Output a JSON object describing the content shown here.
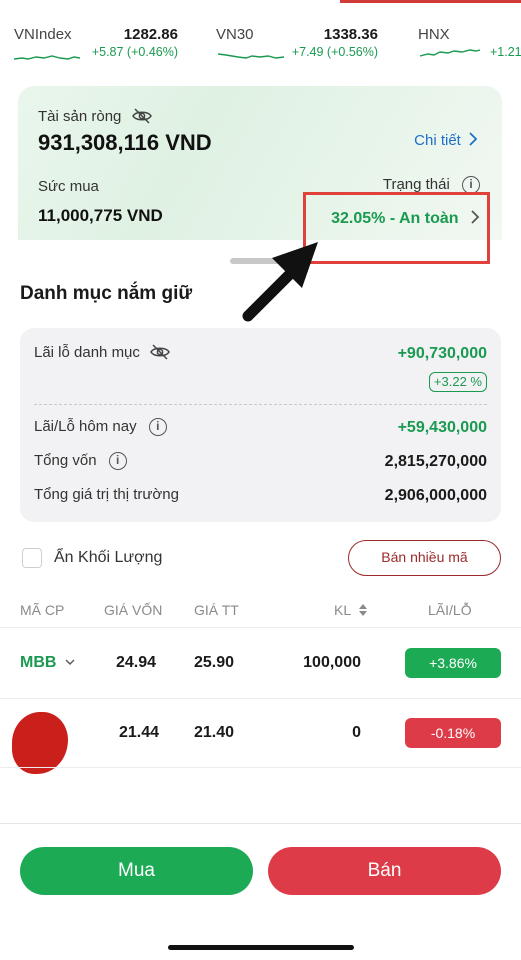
{
  "ticker": [
    {
      "name": "VNIndex",
      "value": "1282.86",
      "change": "+5.87 (+0.46%)"
    },
    {
      "name": "VN30",
      "value": "1338.36",
      "change": "+7.49 (+0.56%)"
    },
    {
      "name": "HNX",
      "value": "",
      "change": "+1.21"
    }
  ],
  "asset": {
    "net_label": "Tài sản ròng",
    "net_value": "931,308,116 VND",
    "detail_link": "Chi tiết",
    "buying_power_label": "Sức mua",
    "buying_power_value": "11,000,775 VND",
    "status_label": "Trạng thái",
    "status_value": "32.05% - An toàn"
  },
  "portfolio": {
    "title": "Danh mục nắm giữ",
    "pnl_label": "Lãi lỗ danh mục",
    "pnl_value": "+90,730,000",
    "pnl_pct": "+3.22 %",
    "today_label": "Lãi/Lỗ hôm nay",
    "today_value": "+59,430,000",
    "capital_label": "Tổng vốn",
    "capital_value": "2,815,270,000",
    "market_label": "Tổng giá trị thị trường",
    "market_value": "2,906,000,000"
  },
  "controls": {
    "hide_volume": "Ẩn Khối Lượng",
    "sell_multi": "Bán nhiều mã"
  },
  "table": {
    "headers": [
      "MÃ CP",
      "GIÁ VỐN",
      "GIÁ TT",
      "KL",
      "LÃI/LỖ"
    ],
    "rows": [
      {
        "code": "MBB",
        "cost": "24.94",
        "price": "25.90",
        "qty": "100,000",
        "pl": "+3.86%",
        "pl_sign": "positive"
      },
      {
        "code": "",
        "cost": "21.44",
        "price": "21.40",
        "qty": "0",
        "pl": "-0.18%",
        "pl_sign": "negative"
      }
    ]
  },
  "actions": {
    "buy": "Mua",
    "sell": "Bán"
  },
  "colors": {
    "up": "#1daa55",
    "down": "#dc3b47",
    "link": "#1e6fc7",
    "highlight_box": "#e0413a"
  }
}
